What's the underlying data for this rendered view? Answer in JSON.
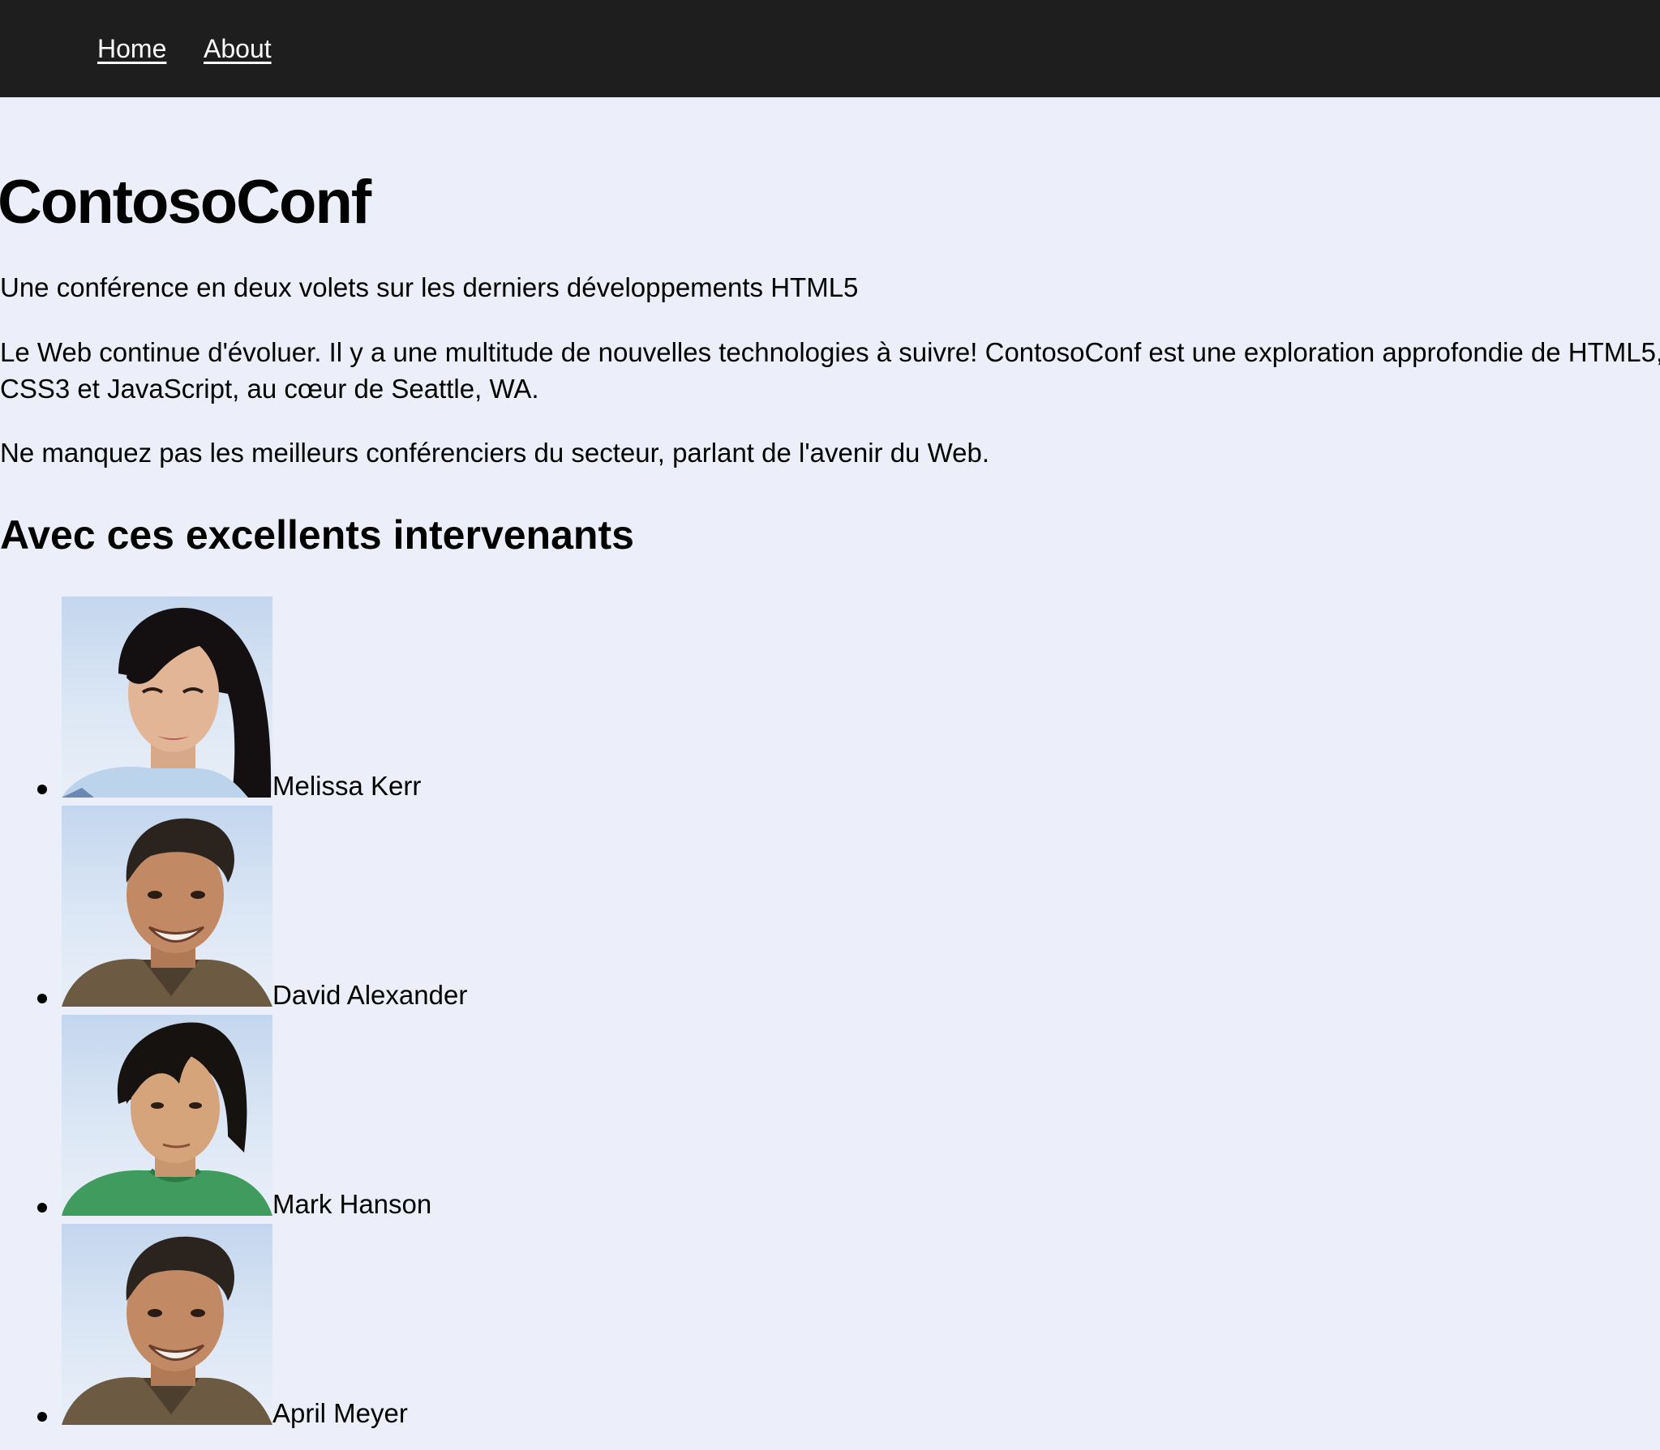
{
  "nav": {
    "home": "Home",
    "about": "About"
  },
  "title": "ContosoConf",
  "tagline": "Une conférence en deux volets sur les derniers développements HTML5",
  "intro": {
    "line1": "Le Web continue d'évoluer. Il y a une multitude de nouvelles technologies à suivre! ContosoConf est une exploration approfondie de HTML5,",
    "line2": "CSS3 et JavaScript, au cœur de Seattle, WA."
  },
  "speakers_intro": "Ne manquez pas les meilleurs conférenciers du secteur, parlant de l'avenir du Web.",
  "speakers_heading": "Avec ces excellents intervenants",
  "speakers": [
    {
      "name": "Melissa Kerr"
    },
    {
      "name": "David Alexander"
    },
    {
      "name": "Mark Hanson"
    },
    {
      "name": "April Meyer"
    }
  ],
  "colors": {
    "nav_background": "#1e1e1e",
    "page_background": "#eceff9",
    "nav_link": "#ffffff"
  }
}
